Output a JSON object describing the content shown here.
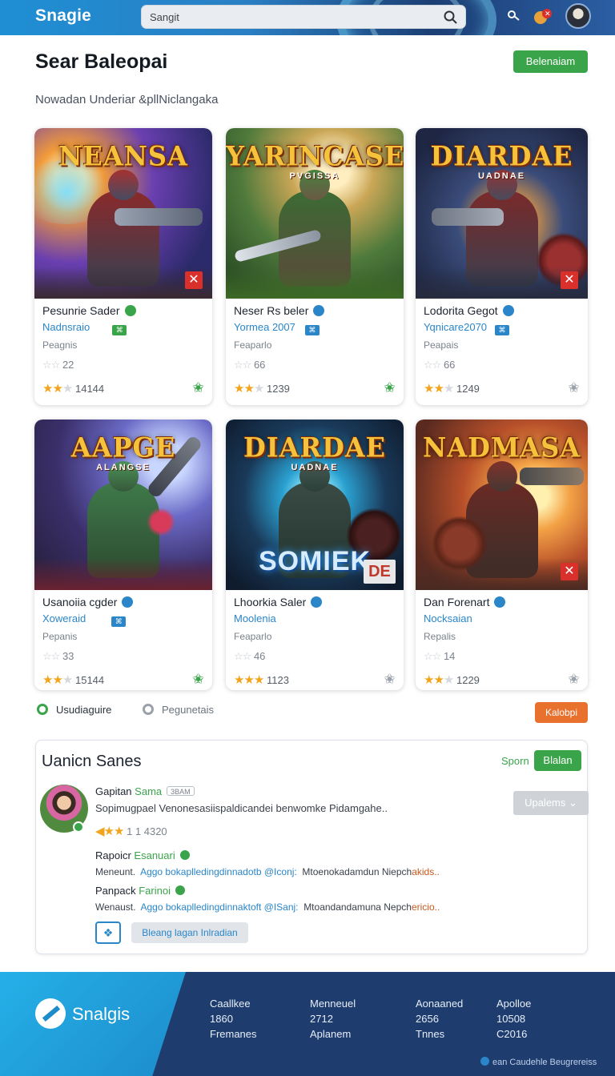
{
  "app": {
    "brand": "Snagie"
  },
  "search": {
    "value": "Sangit"
  },
  "header": {
    "title": "Sear Baleopai",
    "action_label": "Belenaiam",
    "subtitle": "Nowadan Underiar &pllNiclangaka"
  },
  "cards": [
    {
      "art_title": "NEANSA",
      "art_sub": "",
      "name": "Pesunrie Sader",
      "tag": "Nadnsraio",
      "category": "Peagnis",
      "small_rating": "22",
      "rating_count": "14144",
      "rating": 3,
      "fav_icon": "green-star",
      "badge": "✕"
    },
    {
      "art_title": "YARINCASE",
      "art_sub": "PVGISSA",
      "name": "Neser Rs beler",
      "tag": "Yormea 2007",
      "category": "Feaparlo",
      "small_rating": "66",
      "rating_count": "1239",
      "rating": 3,
      "fav_icon": "green-star",
      "badge": ""
    },
    {
      "art_title": "DIARDAE",
      "art_sub": "UADNAE",
      "name": "Lodorita Gegot",
      "tag": "Yqnicare2070",
      "category": "Peapais",
      "small_rating": "66",
      "rating_count": "1249",
      "rating": 3,
      "fav_icon": "grey-star",
      "badge": "✕"
    },
    {
      "art_title": "AAPGE",
      "art_sub": "ALANGSE",
      "name": "Usanoiia cgder",
      "tag": "Xoweraid",
      "category": "Pepanis",
      "small_rating": "33",
      "rating_count": "15144",
      "rating": 3,
      "fav_icon": "green-star",
      "badge": ""
    },
    {
      "art_title": "DIARDAE",
      "art_sub": "UADNAE",
      "name": "Lhoorkia Saler",
      "tag": "Moolenia",
      "category": "Feaparlo",
      "small_rating": "46",
      "rating_count": "1123",
      "rating": 4,
      "fav_icon": "grey-star",
      "badge": "DE",
      "big_text": "SOMIEK"
    },
    {
      "art_title": "NADMASA",
      "art_sub": "",
      "name": "Dan Forenart",
      "tag": "Nocksaian",
      "category": "Repalis",
      "small_rating": "14",
      "rating_count": "1229",
      "rating": 3,
      "fav_icon": "grey-star",
      "badge": "✕"
    }
  ],
  "filters": {
    "first": "Usudiaguire",
    "second": "Pegunetais",
    "action": "Kalobpi"
  },
  "reviews": {
    "title": "Uanicn Sanes",
    "link": "Sporn",
    "button": "Blalan",
    "update_button": "Upalems",
    "main": {
      "name": "Gapitan",
      "name_accent": "Sama",
      "chip": "3BAM",
      "text": "Sopimugpael Venonesasiispaldicandei benwomke Pidamgahe..",
      "rating_text": "1 1 4320"
    },
    "replies": [
      {
        "name": "Rapoicr",
        "name_accent": "Esanuari",
        "label": "Meneunt.",
        "link": "Aggo bokaplledingdinnadotb",
        "mention": "@Iconj:",
        "text": "Mtoenokadamdun Niepch",
        "tail": "akids.."
      },
      {
        "name": "Panpack",
        "name_accent": "Farinoi",
        "label": "Wenaust.",
        "link": "Aggo bokaplledingdinnaktoft",
        "mention": "@ISanj:",
        "text": "Mtoandandamuna Nepch",
        "tail": "ericio.."
      }
    ],
    "bottom_button": "Bleang lagan Inlradian"
  },
  "footer": {
    "brand": "Snalgis",
    "columns": [
      {
        "lines": [
          "Caallkee",
          "1860",
          "Fremanes"
        ]
      },
      {
        "lines": [
          "Menneuel",
          "2712",
          "Aplanem"
        ]
      },
      {
        "lines": [
          "Aonaaned",
          "2656",
          "Tnnes"
        ]
      },
      {
        "lines": [
          "Apolloe",
          "10508",
          "C2016"
        ]
      }
    ],
    "credit": "ean Caudehle Beugrereiss"
  },
  "colors": {
    "accent_green": "#3aa44a",
    "accent_blue": "#2a86c9",
    "accent_orange": "#e8712e",
    "footer_navy": "#1f3c6e",
    "footer_cyan": "#25b0e8"
  }
}
